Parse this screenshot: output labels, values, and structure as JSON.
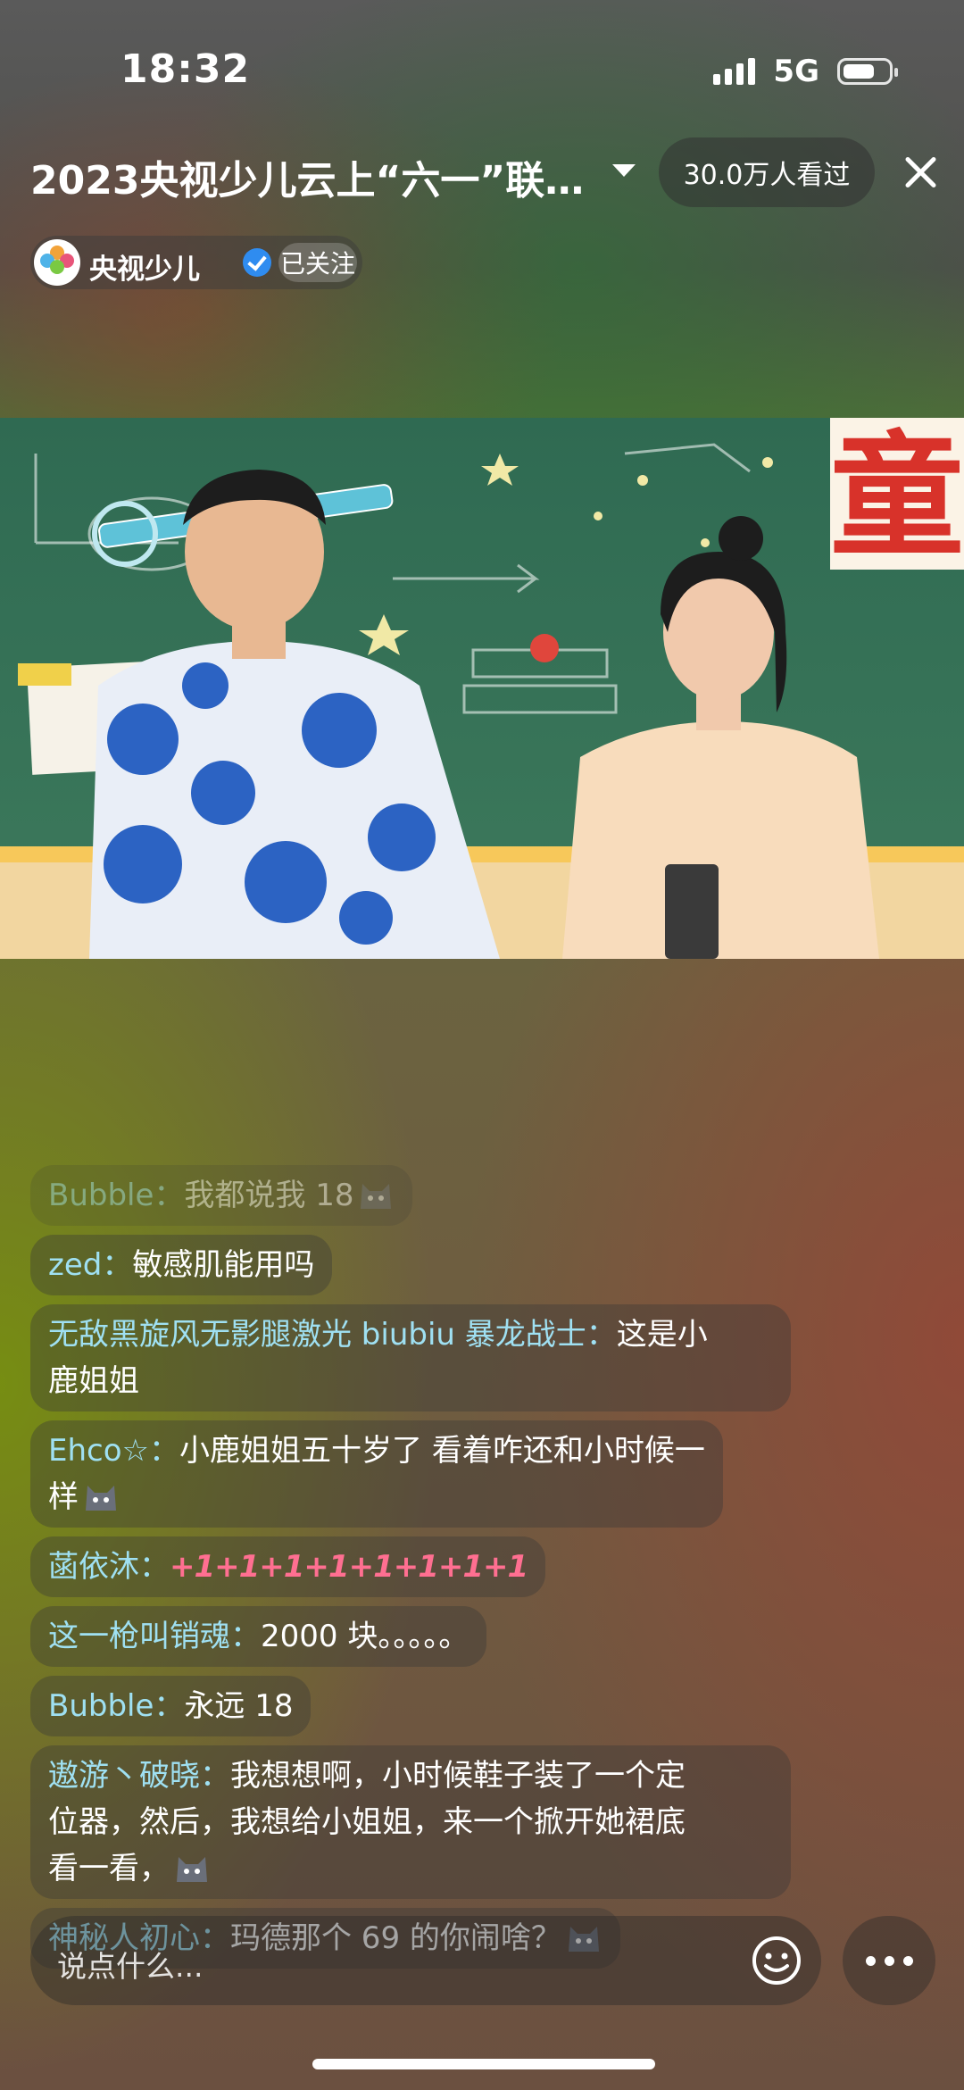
{
  "status_bar": {
    "time": "18:32",
    "network": "5G"
  },
  "header": {
    "title": "2023央视少儿云上“六一”联…",
    "viewers": "30.0万人看过"
  },
  "channel": {
    "logo_text": "央视少儿",
    "name": "央视少儿",
    "follow_label": "已关注"
  },
  "video": {
    "scene_sign": "童"
  },
  "chat": {
    "messages": [
      {
        "user": "Bubble：",
        "text": "我都说我 18",
        "emoji": "cat-emoji"
      },
      {
        "user": "zed：",
        "text": "敏感肌能用吗"
      },
      {
        "user": "无敌黑旋风无影腿激光 biubiu 暴龙战士：",
        "text": "这是小",
        "text2": "鹿姐姐"
      },
      {
        "user": "Ehco☆：",
        "text": "小鹿姐姐五十岁了 看着咋还和小时候一",
        "text2": "样",
        "emoji": "cat-emoji"
      },
      {
        "user": "菡依沐：",
        "text": "+1+1+1+1+1+1+1+1"
      },
      {
        "user": "这一枪叫销魂：",
        "text": "2000 块。。。。。"
      },
      {
        "user": "Bubble：",
        "text": "永远 18"
      },
      {
        "user": "遨游丶破晓：",
        "text": "我想想啊，小时候鞋子装了一个定",
        "text2": "位器，然后，我想给小姐姐，来一个掀开她裙底",
        "text3": "看一看，",
        "emoji": "cat-emoji"
      },
      {
        "user": "神秘人初心：",
        "text": "玛德那个 69 的你闹啥？",
        "emoji": "cat-emoji"
      }
    ]
  },
  "input": {
    "placeholder": "说点什么..."
  },
  "colors": {
    "accent_user": "#9fe0f2",
    "plus_pink": "#ff6f91",
    "verified_blue": "#2f8cf0"
  }
}
